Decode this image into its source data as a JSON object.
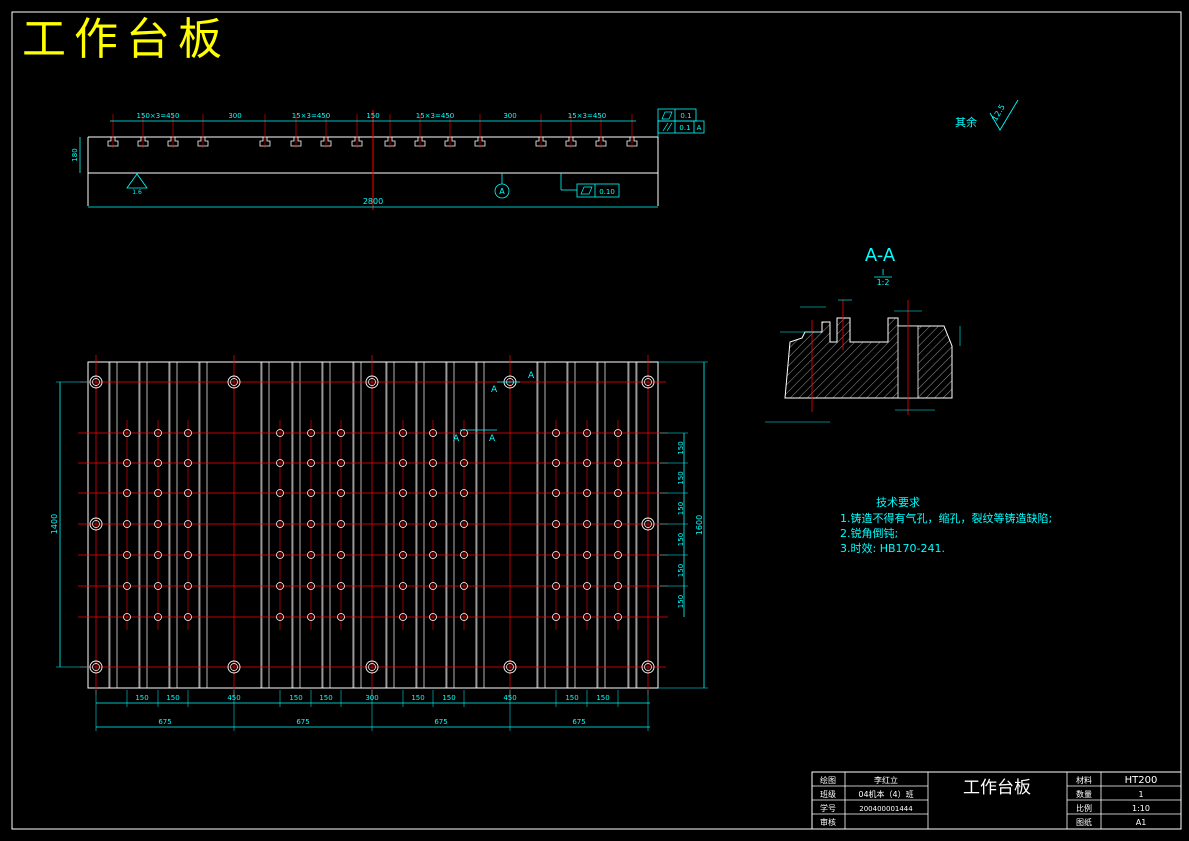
{
  "drawing_title": "工作台板",
  "roughness": {
    "label": "其余",
    "value": "12.5"
  },
  "section": {
    "label": "A-A",
    "scale_top": "I",
    "scale_bottom": "1:2"
  },
  "front_view": {
    "dims_top": [
      "150×3=450",
      "300",
      "15×3=450",
      "150",
      "15×3=450",
      "300",
      "15×3=450"
    ],
    "overall_length": "2800",
    "height": "180",
    "tolerance_flat": "0.1",
    "tolerance_parallel_value": "0.1",
    "tolerance_parallel_datum": "A",
    "tolerance_bottom": "0.10",
    "datum": "A",
    "roughness_small": "1.6"
  },
  "plan_view": {
    "section_marker": "A",
    "left_height": "1400",
    "right_height": "1600",
    "right_spacings": [
      "150",
      "150",
      "150",
      "150",
      "150",
      "150"
    ],
    "bottom_dims_row1": [
      "150",
      "150",
      "450",
      "150",
      "150",
      "300",
      "150",
      "150",
      "450",
      "150",
      "150"
    ],
    "bottom_dims_row2": [
      "675",
      "675",
      "675",
      "675"
    ]
  },
  "tech_requirements": {
    "heading": "技术要求",
    "items": [
      "1.铸造不得有气孔，缩孔，裂纹等铸造缺陷;",
      "2.锐角倒钝;",
      "3.时效: HB170-241."
    ]
  },
  "title_block": {
    "draw_label": "绘图",
    "draw_value": "李红立",
    "class_label": "班级",
    "class_value": "04机本（4）班",
    "id_label": "学号",
    "id_value": "200400001444",
    "review_label": "审核",
    "part_name": "工作台板",
    "material_label": "材料",
    "material_value": "HT200",
    "qty_label": "数量",
    "qty_value": "1",
    "scale_label": "比例",
    "scale_value": "1:10",
    "sheet_label": "图纸",
    "sheet_value": "A1"
  },
  "colors": {
    "line": "#ffffff",
    "dim": "#00ffff",
    "center": "#ff0000",
    "title": "#ffff00"
  }
}
